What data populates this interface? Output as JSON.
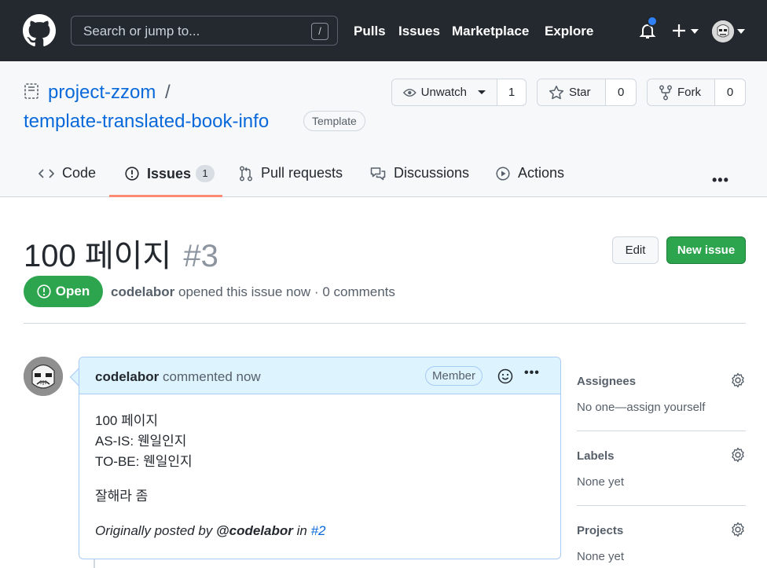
{
  "header": {
    "search_placeholder": "Search or jump to...",
    "search_shortcut": "/",
    "nav": [
      "Pulls",
      "Issues",
      "Marketplace",
      "Explore"
    ]
  },
  "repo": {
    "owner": "project-zzom",
    "separator": "/",
    "name": "template-translated-book-info",
    "badge": "Template",
    "watch_label": "Unwatch",
    "watch_count": "1",
    "star_label": "Star",
    "star_count": "0",
    "fork_label": "Fork",
    "fork_count": "0"
  },
  "tabs": {
    "code": "Code",
    "issues": "Issues",
    "issues_count": "1",
    "pulls": "Pull requests",
    "discussions": "Discussions",
    "actions": "Actions",
    "active": "issues"
  },
  "issue": {
    "title": "100 페이지",
    "number": "#3",
    "edit_label": "Edit",
    "new_issue_label": "New issue",
    "state": "Open",
    "author": "codelabor",
    "meta_text": "opened this issue now · 0 comments"
  },
  "comment": {
    "author": "codelabor",
    "when": "commented now",
    "role_badge": "Member",
    "body_lines": [
      "100 페이지",
      "AS-IS: 웬일인지",
      "TO-BE: 웬일인지"
    ],
    "body_para2": "잘해라 좀",
    "footer_prefix": "Originally posted by",
    "footer_user": "@codelabor",
    "footer_in": "in",
    "footer_link": "#2"
  },
  "sidebar": {
    "assignees_title": "Assignees",
    "assignees_value": "No one—assign yourself",
    "labels_title": "Labels",
    "labels_value": "None yet",
    "projects_title": "Projects",
    "projects_value": "None yet"
  },
  "colors": {
    "header_bg": "#24292f",
    "link": "#0969da",
    "open_green": "#2da44e",
    "notification_dot": "#2f81f7",
    "tab_underline": "#fd8c73"
  },
  "icons": [
    "github-logo-icon",
    "bell-icon",
    "plus-icon",
    "repo-template-icon",
    "eye-icon",
    "star-icon",
    "fork-icon",
    "code-icon",
    "issue-opened-icon",
    "pull-request-icon",
    "discussion-icon",
    "play-icon",
    "kebab-icon",
    "smiley-icon",
    "gear-icon"
  ]
}
